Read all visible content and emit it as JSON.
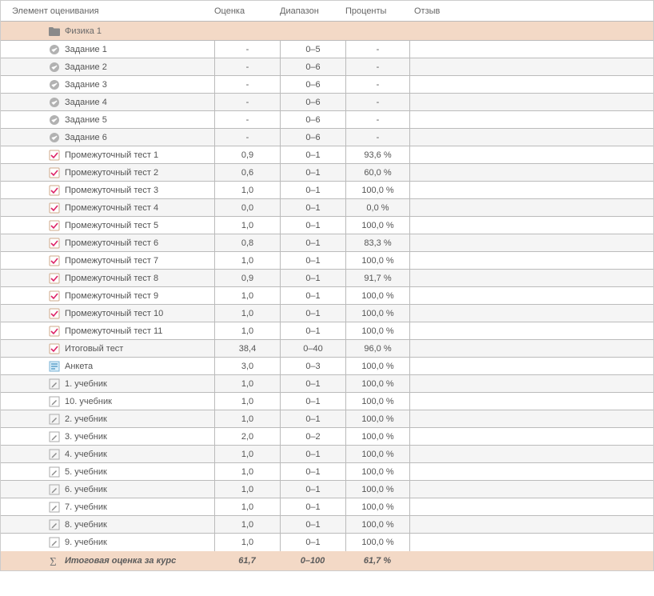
{
  "headers": {
    "item": "Элемент оценивания",
    "grade": "Оценка",
    "range": "Диапазон",
    "percent": "Проценты",
    "feedback": "Отзыв"
  },
  "category": {
    "name": "Физика 1",
    "icon": "folder-icon"
  },
  "items": [
    {
      "icon": "circle-icon",
      "name": "Задание 1",
      "grade": "-",
      "range": "0–5",
      "percent": "-",
      "alt": false
    },
    {
      "icon": "circle-icon",
      "name": "Задание 2",
      "grade": "-",
      "range": "0–6",
      "percent": "-",
      "alt": true
    },
    {
      "icon": "circle-icon",
      "name": "Задание 3",
      "grade": "-",
      "range": "0–6",
      "percent": "-",
      "alt": false
    },
    {
      "icon": "circle-icon",
      "name": "Задание 4",
      "grade": "-",
      "range": "0–6",
      "percent": "-",
      "alt": true
    },
    {
      "icon": "circle-icon",
      "name": "Задание 5",
      "grade": "-",
      "range": "0–6",
      "percent": "-",
      "alt": false
    },
    {
      "icon": "circle-icon",
      "name": "Задание 6",
      "grade": "-",
      "range": "0–6",
      "percent": "-",
      "alt": true
    },
    {
      "icon": "check-icon",
      "name": "Промежуточный тест 1",
      "grade": "0,9",
      "range": "0–1",
      "percent": "93,6 %",
      "alt": false
    },
    {
      "icon": "check-icon",
      "name": "Промежуточный тест 2",
      "grade": "0,6",
      "range": "0–1",
      "percent": "60,0 %",
      "alt": true
    },
    {
      "icon": "check-icon",
      "name": "Промежуточный тест 3",
      "grade": "1,0",
      "range": "0–1",
      "percent": "100,0 %",
      "alt": false
    },
    {
      "icon": "check-icon",
      "name": "Промежуточный тест 4",
      "grade": "0,0",
      "range": "0–1",
      "percent": "0,0 %",
      "alt": true
    },
    {
      "icon": "check-icon",
      "name": "Промежуточный тест 5",
      "grade": "1,0",
      "range": "0–1",
      "percent": "100,0 %",
      "alt": false
    },
    {
      "icon": "check-icon",
      "name": "Промежуточный тест 6",
      "grade": "0,8",
      "range": "0–1",
      "percent": "83,3 %",
      "alt": true
    },
    {
      "icon": "check-icon",
      "name": "Промежуточный тест 7",
      "grade": "1,0",
      "range": "0–1",
      "percent": "100,0 %",
      "alt": false
    },
    {
      "icon": "check-icon",
      "name": "Промежуточный тест 8",
      "grade": "0,9",
      "range": "0–1",
      "percent": "91,7 %",
      "alt": true
    },
    {
      "icon": "check-icon",
      "name": "Промежуточный тест 9",
      "grade": "1,0",
      "range": "0–1",
      "percent": "100,0 %",
      "alt": false
    },
    {
      "icon": "check-icon",
      "name": "Промежуточный тест 10",
      "grade": "1,0",
      "range": "0–1",
      "percent": "100,0 %",
      "alt": true
    },
    {
      "icon": "check-icon",
      "name": "Промежуточный тест 11",
      "grade": "1,0",
      "range": "0–1",
      "percent": "100,0 %",
      "alt": false
    },
    {
      "icon": "check-icon",
      "name": "Итоговый тест",
      "grade": "38,4",
      "range": "0–40",
      "percent": "96,0 %",
      "alt": true
    },
    {
      "icon": "survey-icon",
      "name": "Анкета",
      "grade": "3,0",
      "range": "0–3",
      "percent": "100,0 %",
      "alt": false
    },
    {
      "icon": "edit-icon",
      "name": "1. учебник",
      "grade": "1,0",
      "range": "0–1",
      "percent": "100,0 %",
      "alt": true
    },
    {
      "icon": "edit-icon",
      "name": "10. учебник",
      "grade": "1,0",
      "range": "0–1",
      "percent": "100,0 %",
      "alt": false
    },
    {
      "icon": "edit-icon",
      "name": "2. учебник",
      "grade": "1,0",
      "range": "0–1",
      "percent": "100,0 %",
      "alt": true
    },
    {
      "icon": "edit-icon",
      "name": "3. учебник",
      "grade": "2,0",
      "range": "0–2",
      "percent": "100,0 %",
      "alt": false
    },
    {
      "icon": "edit-icon",
      "name": "4. учебник",
      "grade": "1,0",
      "range": "0–1",
      "percent": "100,0 %",
      "alt": true
    },
    {
      "icon": "edit-icon",
      "name": "5. учебник",
      "grade": "1,0",
      "range": "0–1",
      "percent": "100,0 %",
      "alt": false
    },
    {
      "icon": "edit-icon",
      "name": "6. учебник",
      "grade": "1,0",
      "range": "0–1",
      "percent": "100,0 %",
      "alt": true
    },
    {
      "icon": "edit-icon",
      "name": "7. учебник",
      "grade": "1,0",
      "range": "0–1",
      "percent": "100,0 %",
      "alt": false
    },
    {
      "icon": "edit-icon",
      "name": "8. учебник",
      "grade": "1,0",
      "range": "0–1",
      "percent": "100,0 %",
      "alt": true
    },
    {
      "icon": "edit-icon",
      "name": "9. учебник",
      "grade": "1,0",
      "range": "0–1",
      "percent": "100,0 %",
      "alt": false
    }
  ],
  "total": {
    "icon": "sigma-icon",
    "name": "Итоговая оценка за курс",
    "grade": "61,7",
    "range": "0–100",
    "percent": "61,7 %"
  }
}
